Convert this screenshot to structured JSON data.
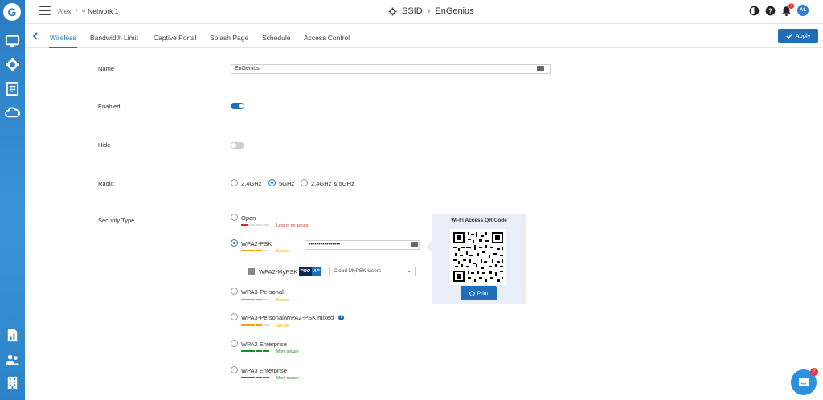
{
  "header": {
    "breadcrumb_user": "Alex",
    "breadcrumb_separator": "/",
    "breadcrumb_network": "Network 1",
    "title_prefix": "SSID",
    "title_separator": "›",
    "title_name": "EnGenius",
    "notification_count": "2",
    "avatar_initials": "AL"
  },
  "tabs": [
    "Wireless",
    "Bandwidth Limit",
    "Captive Portal",
    "Splash Page",
    "Schedule",
    "Access Control"
  ],
  "apply_label": "Apply",
  "form": {
    "name_label": "Name",
    "name_value": "EnGenius",
    "enabled_label": "Enabled",
    "enabled": true,
    "hide_label": "Hide",
    "hide": false,
    "radio_label": "Radio",
    "radio_options": [
      "2.4GHz",
      "5GHz",
      "2.4GHz & 5GHz"
    ],
    "radio_selected": "5GHz",
    "security_label": "Security Type"
  },
  "security": {
    "open": {
      "label": "Open",
      "level_text": "Less or no secure"
    },
    "wpa2psk": {
      "label": "WPA2-PSK",
      "level_text": "Secure",
      "password": "••••••••••••••••"
    },
    "mypsk": {
      "label": "WPA2-MyPSK",
      "badge_pro": "PRO",
      "badge_ap": "AP",
      "select_value": "Cloud MyPSK Users"
    },
    "wpa3personal": {
      "label": "WPA3-Personal",
      "level_text": "Secure"
    },
    "wpa3mixed": {
      "label": "WPA3-Personal/WPA2-PSK mixed",
      "level_text": "Secure"
    },
    "wpa2ent": {
      "label": "WPA2 Enterprise",
      "level_text": "More secure"
    },
    "wpa3ent": {
      "label": "WPA3 Enterprise",
      "level_text": "More secure"
    }
  },
  "qr": {
    "title": "Wi-Fi Access QR Code",
    "print_label": "Print"
  },
  "chat_badge": "7",
  "colors": {
    "accent": "#1f6fb8",
    "weak": "#d32f2f",
    "medium": "#f0a500",
    "strong": "#1e8e1e"
  }
}
